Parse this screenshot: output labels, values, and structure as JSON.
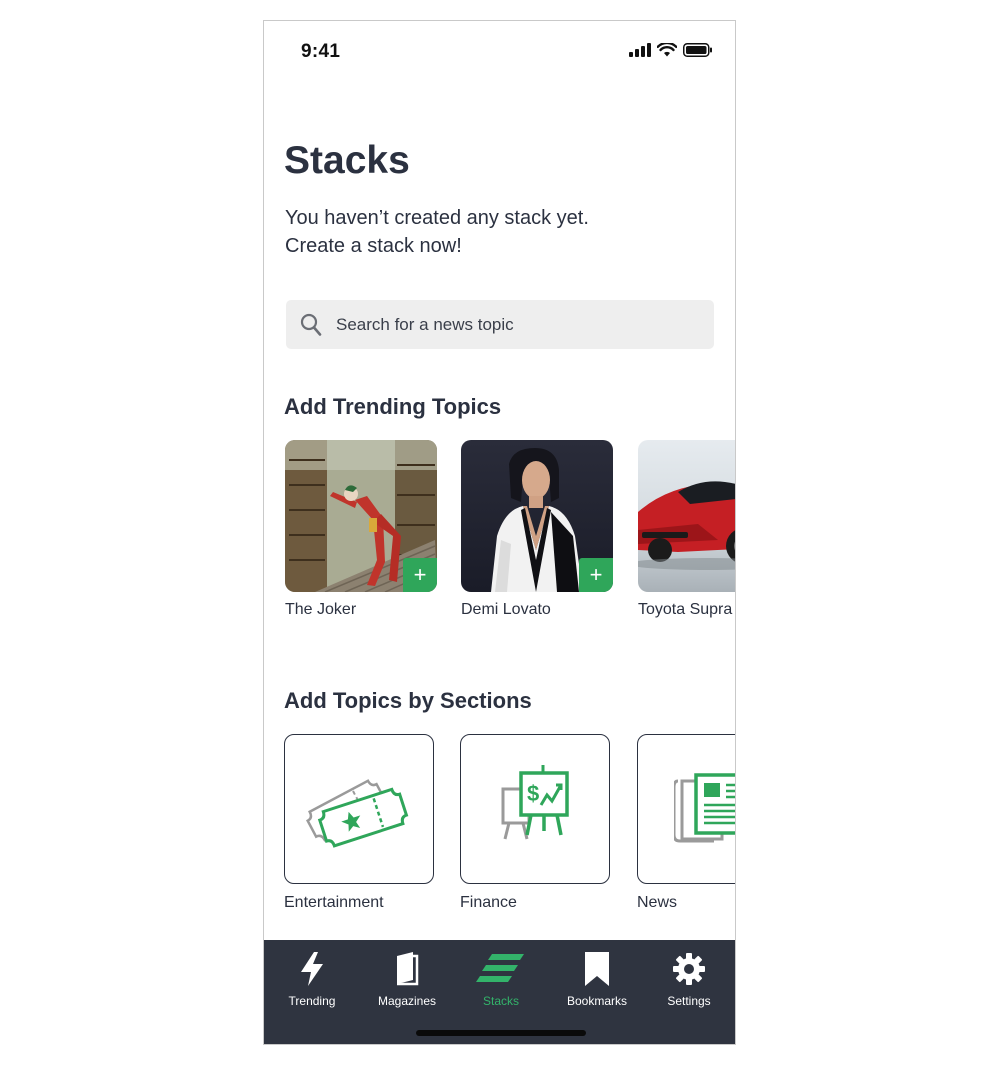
{
  "status": {
    "time": "9:41"
  },
  "page": {
    "title": "Stacks",
    "intro_line1": "You haven’t created any stack yet.",
    "intro_line2": "Create a stack now!"
  },
  "search": {
    "placeholder": "Search for a news topic",
    "icon": "search-icon"
  },
  "trending": {
    "title": "Add Trending Topics",
    "items": [
      {
        "label": "The Joker",
        "add": "+"
      },
      {
        "label": "Demi Lovato",
        "add": "+"
      },
      {
        "label": "Toyota Supra"
      }
    ]
  },
  "sections": {
    "title": "Add Topics by Sections",
    "items": [
      {
        "label": "Entertainment",
        "icon": "tickets-icon"
      },
      {
        "label": "Finance",
        "icon": "finance-chart-icon"
      },
      {
        "label": "News",
        "icon": "newspaper-icon"
      }
    ]
  },
  "tabs": [
    {
      "label": "Trending",
      "icon": "lightning-icon"
    },
    {
      "label": "Magazines",
      "icon": "magazine-icon"
    },
    {
      "label": "Stacks",
      "icon": "stacks-icon",
      "active": true
    },
    {
      "label": "Bookmarks",
      "icon": "bookmark-icon"
    },
    {
      "label": "Settings",
      "icon": "gear-icon"
    }
  ],
  "colors": {
    "accent": "#2fa65a",
    "text": "#2b3140",
    "tabbar": "#2f3440",
    "search_bg": "#eeeeee"
  }
}
